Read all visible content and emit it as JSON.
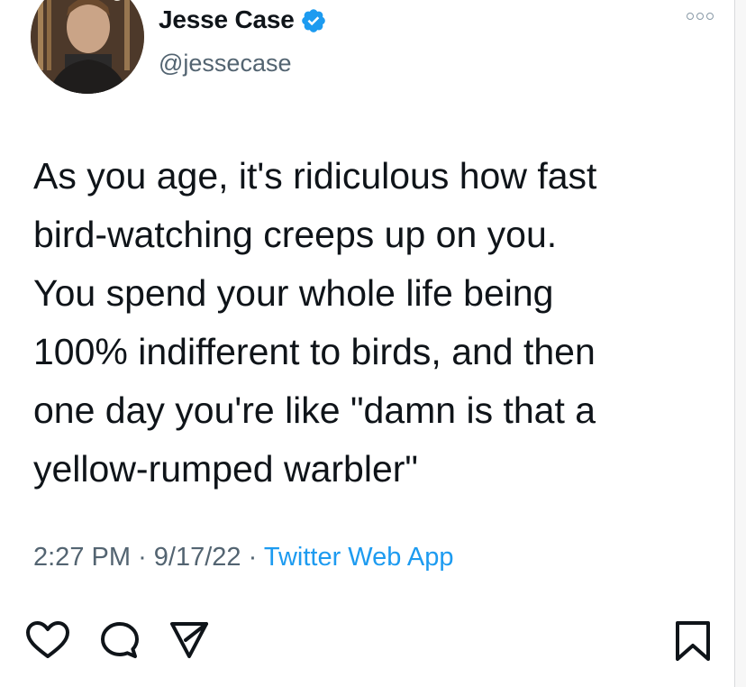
{
  "author": {
    "name": "Jesse Case",
    "handle": "@jessecase",
    "verified_icon": "verified-badge-icon",
    "verified_color": "#1d9bf0"
  },
  "menu_icon": "more-dots-icon",
  "tweet": {
    "lines": [
      "As you age, it's ridiculous how fast",
      "bird-watching creeps up on you.",
      "You spend your whole life being",
      "100% indifferent to birds, and then",
      "one day you're like \"damn is that a",
      "yellow-rumped warbler\""
    ],
    "time": "2:27 PM",
    "separator": "·",
    "date": "9/17/22",
    "source": "Twitter Web App"
  },
  "actions": {
    "like_icon": "heart-icon",
    "reply_icon": "speech-bubble-icon",
    "share_icon": "send-arrow-icon",
    "save_icon": "bookmark-icon"
  },
  "colors": {
    "text": "#0f1419",
    "secondary": "#536471",
    "link": "#1d9bf0"
  }
}
